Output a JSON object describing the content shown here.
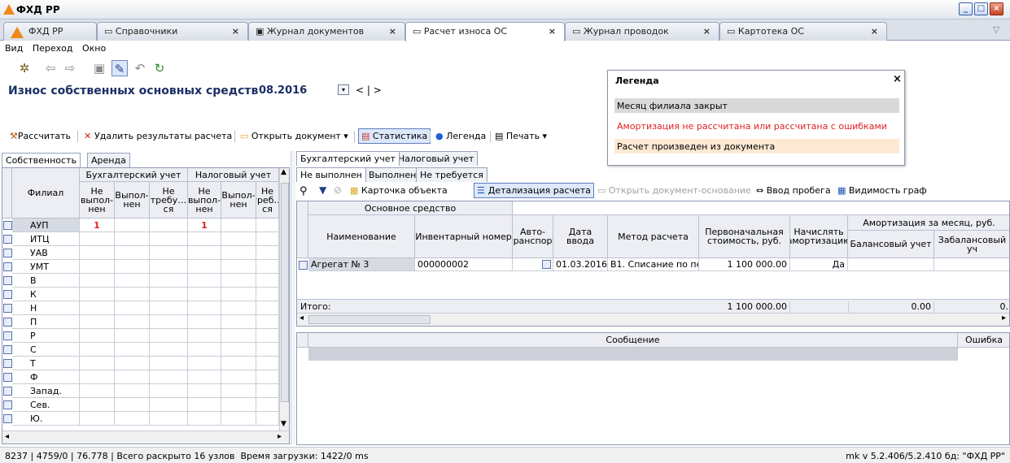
{
  "window": {
    "title": "ФХД РР",
    "min": "_",
    "max": "□",
    "close": "×"
  },
  "doc_tabs": [
    {
      "label": "ФХД РР"
    },
    {
      "label": "Справочники"
    },
    {
      "label": "Журнал документов"
    },
    {
      "label": "Расчет износа ОС"
    },
    {
      "label": "Журнал проводок"
    },
    {
      "label": "Картотека ОС"
    }
  ],
  "menu": [
    "Вид",
    "Переход",
    "Окно"
  ],
  "page": {
    "title": "Износ собственных основных средств",
    "period": "08.2016",
    "nav_prev": "<",
    "nav_sep": "|",
    "nav_next": ">"
  },
  "actions": {
    "calc": "Рассчитать",
    "delete": "Удалить результаты расчета",
    "open_doc": "Открыть документ",
    "stats": "Статистика",
    "legend": "Легенда",
    "print": "Печать"
  },
  "left_tabs": [
    "Собственность",
    "Аренда"
  ],
  "left_grid": {
    "group1": "Бухгалтерский учет",
    "group2": "Налоговый учет",
    "col_filial": "Филиал",
    "cols": [
      "Не выпол-нен",
      "Выпол-нен",
      "Не требу…ся",
      "Не выпол-нен",
      "Выпол-нен",
      "Не треб…ся"
    ],
    "rows": [
      {
        "name": "АУП",
        "v1": "1",
        "v4": "1"
      },
      {
        "name": "ИТЦ"
      },
      {
        "name": "УАВ"
      },
      {
        "name": "УМТ"
      },
      {
        "name": "В"
      },
      {
        "name": "К"
      },
      {
        "name": "Н"
      },
      {
        "name": "П"
      },
      {
        "name": "Р"
      },
      {
        "name": "С"
      },
      {
        "name": "Т"
      },
      {
        "name": "Ф"
      },
      {
        "name": "Запад."
      },
      {
        "name": "Сев."
      },
      {
        "name": "Ю."
      }
    ]
  },
  "acc_tabs": [
    "Бухгалтерский учет",
    "Налоговый учет"
  ],
  "status_tabs": [
    "Не выполнен",
    "Выполнен",
    "Не требуется"
  ],
  "toolbar2": {
    "card": "Карточка объекта",
    "detail": "Детализация расчета",
    "open_base": "Открыть документ-основание",
    "mileage": "Ввод пробега",
    "visibility": "Видимость граф"
  },
  "main_grid": {
    "group_os": "Основное средство",
    "group_amort": "Амортизация за месяц, руб.",
    "cols": [
      "Наименование",
      "Инвентарный номер",
      "Авто-транспорт",
      "Дата ввода",
      "Метод расчета",
      "Первоначальная стоимость, руб.",
      "Начислять амортизацию",
      "Балансовый учет",
      "Забалансовый уч"
    ],
    "row": {
      "name": "Агрегат № 3",
      "inv": "000000002",
      "date": "01.03.2016",
      "method": "В1. Списание по пе",
      "cost": "1 100 000.00",
      "amort": "Да"
    },
    "total_label": "Итого:",
    "total_cost": "1 100 000.00",
    "total_bal": "0.00",
    "total_off": "0."
  },
  "msg_grid": {
    "col_msg": "Сообщение",
    "col_err": "Ошибка"
  },
  "legend": {
    "title": "Легенда",
    "close": "×",
    "items": [
      {
        "text": "Месяц филиала закрыт",
        "bg": "#d9d9d9",
        "color": "#000000"
      },
      {
        "text": "Амортизация не рассчитана или рассчитана с ошибками",
        "bg": "#ffffff",
        "color": "#e02020"
      },
      {
        "text": "Расчет произведен из документа",
        "bg": "#fde9d3",
        "color": "#000000"
      }
    ]
  },
  "status": {
    "s1": "8237",
    "s2": "4759/0",
    "s3": "76.778",
    "s4": "Всего раскрыто 16 узлов",
    "s5": "Время загрузки: 1422/0 ms",
    "version": "mk v 5.2.406/5.2.410 бд: \"ФХД РР\""
  }
}
